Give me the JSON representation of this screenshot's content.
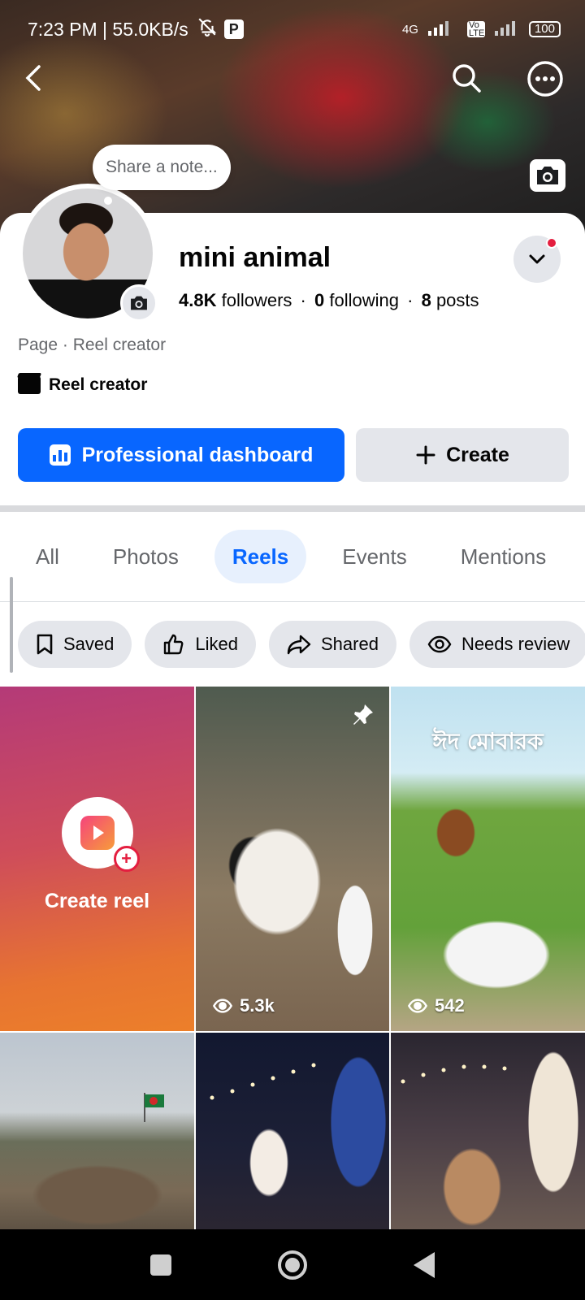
{
  "status_bar": {
    "time": "7:23 PM | 55.0KB/s",
    "network": "4G",
    "volte": "Vo LTE",
    "battery": "100"
  },
  "profile": {
    "note_placeholder": "Share a note...",
    "name": "mini animal",
    "followers_count": "4.8K",
    "followers_label": "followers",
    "following_count": "0",
    "following_label": "following",
    "posts_count": "8",
    "posts_label": "posts",
    "separator": "·",
    "category": "Page · Reel creator",
    "badge_label": "Reel creator"
  },
  "actions": {
    "professional_dashboard": "Professional dashboard",
    "create": "Create"
  },
  "tabs": [
    {
      "label": "All",
      "active": false
    },
    {
      "label": "Photos",
      "active": false
    },
    {
      "label": "Reels",
      "active": true
    },
    {
      "label": "Events",
      "active": false
    },
    {
      "label": "Mentions",
      "active": false
    }
  ],
  "filters": [
    {
      "label": "Saved",
      "icon": "bookmark-icon"
    },
    {
      "label": "Liked",
      "icon": "thumbs-up-icon"
    },
    {
      "label": "Shared",
      "icon": "share-icon"
    },
    {
      "label": "Needs review",
      "icon": "eye-icon"
    }
  ],
  "reels": {
    "create_label": "Create reel",
    "items": [
      {
        "views": "5.3k",
        "pinned": true
      },
      {
        "views": "542",
        "overlay_text": "ঈদ মোবারক"
      },
      {
        "views": ""
      },
      {
        "views": ""
      },
      {
        "views": ""
      }
    ]
  },
  "colors": {
    "primary": "#0866ff",
    "active_tab_bg": "#e7f0fd",
    "secondary_button": "#e4e6eb",
    "notification_dot": "#e41e3f"
  }
}
